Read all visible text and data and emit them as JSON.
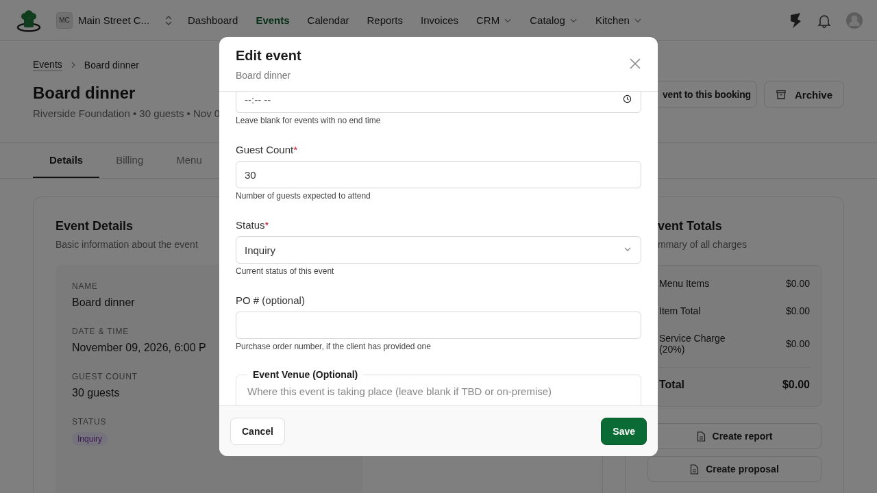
{
  "nav": {
    "brand": {
      "initials": "MC",
      "name": "Main Street C..."
    },
    "items": [
      {
        "label": "Dashboard",
        "selected": false,
        "dropdown": false
      },
      {
        "label": "Events",
        "selected": true,
        "dropdown": false
      },
      {
        "label": "Calendar",
        "selected": false,
        "dropdown": false
      },
      {
        "label": "Reports",
        "selected": false,
        "dropdown": false
      },
      {
        "label": "Invoices",
        "selected": false,
        "dropdown": false
      },
      {
        "label": "CRM",
        "selected": false,
        "dropdown": true
      },
      {
        "label": "Catalog",
        "selected": false,
        "dropdown": true
      },
      {
        "label": "Kitchen",
        "selected": false,
        "dropdown": true
      }
    ]
  },
  "page": {
    "breadcrumb": [
      "Events",
      "Board dinner"
    ],
    "title": "Board dinner",
    "subtitle": "Riverside Foundation • 30 guests • Nov 0",
    "actions": [
      {
        "label": "vent to this booking",
        "kind": "plain"
      },
      {
        "label": "Archive",
        "kind": "archive"
      }
    ],
    "tabs": [
      {
        "label": "Details",
        "selected": true
      },
      {
        "label": "Billing",
        "selected": false
      },
      {
        "label": "Menu",
        "selected": false
      }
    ],
    "details": {
      "title": "Event Details",
      "subtitle": "Basic information about the event",
      "fields": [
        {
          "kind": "text",
          "label": "NAME",
          "value": "Board dinner"
        },
        {
          "kind": "text",
          "label": "DATE & TIME",
          "value": "November 09, 2026, 6:00 P"
        },
        {
          "kind": "text",
          "label": "GUEST COUNT",
          "value": "30 guests"
        },
        {
          "kind": "badge",
          "label": "STATUS",
          "value": "Inquiry"
        }
      ]
    },
    "totals": {
      "title": "vent Totals",
      "subtitle": "mmary of all charges",
      "rows": [
        {
          "label": "Menu Items",
          "value": "$0.00",
          "total": false
        },
        {
          "label": "Item Total",
          "value": "$0.00",
          "total": false
        },
        {
          "label": "Service Charge (20%)",
          "value": "$0.00",
          "total": false
        },
        {
          "label": "Total",
          "value": "$0.00",
          "total": true
        }
      ],
      "buttons": [
        "Create report",
        "Create proposal"
      ]
    }
  },
  "modal": {
    "title": "Edit event",
    "subtitle": "Board dinner",
    "fields": [
      {
        "kind": "time",
        "placeholder": "--:-- --",
        "help": "Leave blank for events with no end time"
      },
      {
        "kind": "number",
        "label": "Guest Count",
        "required_mark": "*",
        "value": "30",
        "help": "Number of guests expected to attend"
      },
      {
        "kind": "select",
        "label": "Status",
        "required_mark": "*",
        "value": "Inquiry",
        "help": "Current status of this event"
      },
      {
        "kind": "text",
        "label": "PO # (optional)",
        "help": "Purchase order number, if the client has provided one"
      },
      {
        "kind": "fieldset",
        "label": "Event Venue (Optional)",
        "placeholder": "Where this event is taking place (leave blank if TBD or on-premise)"
      }
    ],
    "cancel": "Cancel",
    "save": "Save"
  }
}
